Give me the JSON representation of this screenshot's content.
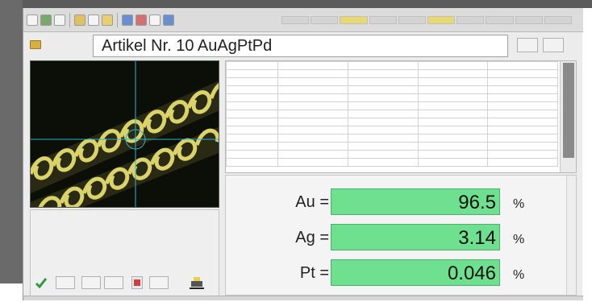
{
  "app": {
    "title": "Artikel Nr. 10  AuAgPtPd",
    "small_field_label": "",
    "toolbar_icons": [
      "open-icon",
      "save-icon",
      "print-icon",
      "zoom-icon",
      "settings-icon",
      "chart-icon",
      "camera-icon",
      "measure-icon",
      "filter-icon",
      "info-icon"
    ],
    "right_buttons": [
      "",
      ""
    ]
  },
  "table": {
    "header": [
      "",
      "",
      "",
      "",
      ""
    ],
    "rows": [
      [
        "",
        "",
        "",
        "",
        ""
      ],
      [
        "",
        "",
        "",
        "",
        ""
      ],
      [
        "",
        "",
        "",
        "",
        ""
      ],
      [
        "",
        "",
        "",
        "",
        ""
      ],
      [
        "",
        "",
        "",
        "",
        ""
      ],
      [
        "",
        "",
        "",
        "",
        ""
      ],
      [
        "",
        "",
        "",
        "",
        ""
      ],
      [
        "",
        "",
        "",
        "",
        ""
      ],
      [
        "",
        "",
        "",
        "",
        ""
      ],
      [
        "",
        "",
        "",
        "",
        ""
      ],
      [
        "",
        "",
        "",
        "",
        ""
      ],
      [
        "",
        "",
        "",
        "",
        ""
      ]
    ]
  },
  "results": {
    "header": "",
    "items": [
      {
        "element": "Au =",
        "value": "96.5",
        "uncertainty": "",
        "unit": "%"
      },
      {
        "element": "Ag =",
        "value": "3.14",
        "uncertainty": "",
        "unit": "%"
      },
      {
        "element": "Pt =",
        "value": "0.046",
        "uncertainty": "",
        "unit": "%"
      }
    ],
    "value_color": "#6fe08f"
  },
  "bottom_tools": {
    "buttons": [
      "",
      "",
      "",
      "",
      ""
    ]
  },
  "colors": {
    "accent_green": "#6fe08f",
    "chain_gold": "#d9d36a"
  }
}
